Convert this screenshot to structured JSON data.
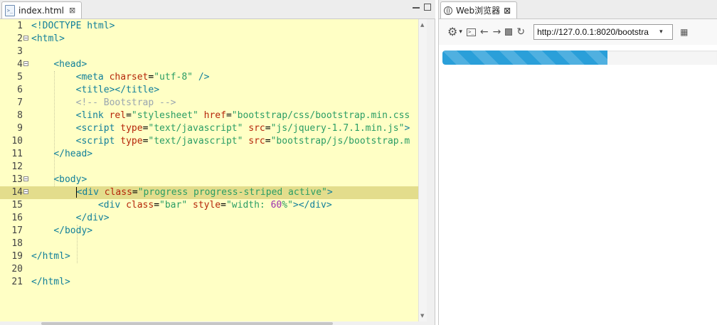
{
  "editor": {
    "tab_label": "index.html",
    "tab_close": "⊠",
    "file_icon": "</>",
    "lines": [
      {
        "n": "1",
        "fold": false,
        "hl": false,
        "html": "<span class=\"tag\">&lt;!DOCTYPE html&gt;</span>"
      },
      {
        "n": "2",
        "fold": true,
        "hl": false,
        "html": "<span class=\"tag\">&lt;html&gt;</span>"
      },
      {
        "n": "3",
        "fold": false,
        "hl": false,
        "html": ""
      },
      {
        "n": "4",
        "fold": true,
        "hl": false,
        "html": "    <span class=\"tag\">&lt;head&gt;</span>"
      },
      {
        "n": "5",
        "fold": false,
        "hl": false,
        "html": "        <span class=\"tag\">&lt;meta</span> <span class=\"attr\">charset</span>=<span class=\"val\">\"utf-8\"</span> <span class=\"tag\">/&gt;</span>"
      },
      {
        "n": "6",
        "fold": false,
        "hl": false,
        "html": "        <span class=\"tag\">&lt;title&gt;&lt;/title&gt;</span>"
      },
      {
        "n": "7",
        "fold": false,
        "hl": false,
        "html": "        <span class=\"cmt\">&lt;!-- Bootstrap --&gt;</span>"
      },
      {
        "n": "8",
        "fold": false,
        "hl": false,
        "html": "        <span class=\"tag\">&lt;link</span> <span class=\"attr\">rel</span>=<span class=\"val\">\"stylesheet\"</span> <span class=\"attr\">href</span>=<span class=\"val\">\"bootstrap/css/bootstrap.min.css</span>"
      },
      {
        "n": "9",
        "fold": false,
        "hl": false,
        "html": "        <span class=\"tag\">&lt;script</span> <span class=\"attr\">type</span>=<span class=\"val\">\"text/javascript\"</span> <span class=\"attr\">src</span>=<span class=\"val\">\"js/jquery-1.7.1.min.js\"</span><span class=\"tag\">&gt;</span>"
      },
      {
        "n": "10",
        "fold": false,
        "hl": false,
        "html": "        <span class=\"tag\">&lt;script</span> <span class=\"attr\">type</span>=<span class=\"val\">\"text/javascript\"</span> <span class=\"attr\">src</span>=<span class=\"val\">\"bootstrap/js/bootstrap.m</span>"
      },
      {
        "n": "11",
        "fold": false,
        "hl": false,
        "html": "    <span class=\"tag\">&lt;/head&gt;</span>"
      },
      {
        "n": "12",
        "fold": false,
        "hl": false,
        "html": ""
      },
      {
        "n": "13",
        "fold": true,
        "hl": false,
        "html": "    <span class=\"tag\">&lt;body&gt;</span>"
      },
      {
        "n": "14",
        "fold": true,
        "hl": true,
        "html": "        <span class=\"cursor\"></span><span class=\"tag\">&lt;div</span> <span class=\"attr\">class</span>=<span class=\"val\">\"progress progress-striped active\"</span><span class=\"tag\">&gt;</span>"
      },
      {
        "n": "15",
        "fold": false,
        "hl": false,
        "html": "            <span class=\"tag\">&lt;div</span> <span class=\"attr\">class</span>=<span class=\"val\">\"bar\"</span> <span class=\"attr\">style</span>=<span class=\"val\">\"width: </span><span class=\"num\">60</span><span class=\"val\">%\"</span><span class=\"tag\">&gt;&lt;/div&gt;</span>"
      },
      {
        "n": "16",
        "fold": false,
        "hl": false,
        "html": "        <span class=\"tag\">&lt;/div&gt;</span>"
      },
      {
        "n": "17",
        "fold": false,
        "hl": false,
        "html": "    <span class=\"tag\">&lt;/body&gt;</span>"
      },
      {
        "n": "18",
        "fold": false,
        "hl": false,
        "html": ""
      },
      {
        "n": "19",
        "fold": false,
        "hl": false,
        "html": "<span class=\"tag\">&lt;/html&gt;</span>"
      },
      {
        "n": "20",
        "fold": false,
        "hl": false,
        "html": ""
      },
      {
        "n": "21",
        "fold": false,
        "hl": false,
        "html": "<span class=\"tag\">&lt;/html&gt;</span>"
      }
    ]
  },
  "browser": {
    "tab_label": "Web浏览器",
    "tab_close": "⊠",
    "url": "http://127.0.0.1:8020/bootstra",
    "progress_fraction": 0.6,
    "colors": {
      "bar": "#2a9fd9",
      "editor_bg": "#ffffc5",
      "highlight": "#e3dd8c"
    }
  },
  "icons": {
    "gear": "⚙",
    "caret": "▾",
    "terminal": ">_",
    "back": "←",
    "forward": "→",
    "reload": "↻",
    "grid": "▦",
    "fold": "−",
    "up": "▲",
    "down": "▼"
  }
}
